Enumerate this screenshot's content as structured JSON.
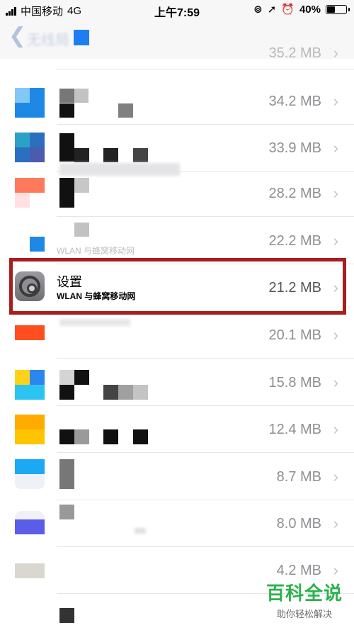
{
  "status_bar": {
    "carrier": "中国移动",
    "network": "4G",
    "time": "上午7:59",
    "battery": "40%",
    "battery_level": 0.4
  },
  "nav": {
    "back_label": "无线局"
  },
  "partial_top_size": "35.2 MB",
  "rows": [
    {
      "size": "34.2 MB"
    },
    {
      "size": "33.9 MB"
    },
    {
      "size": "28.2 MB"
    },
    {
      "size": "22.2 MB",
      "subtitle": "WLAN 与蜂窝移动网"
    },
    {
      "size": "21.2 MB",
      "name": "设置",
      "subtitle": "WLAN 与蜂窝移动网"
    },
    {
      "size": "20.1 MB"
    },
    {
      "size": "15.8 MB"
    },
    {
      "size": "12.4 MB"
    },
    {
      "size": "8.7 MB"
    },
    {
      "size": "8.0 MB"
    },
    {
      "size": "4.2 MB"
    }
  ],
  "watermark": {
    "title": "百科全说",
    "subtitle": "助你轻松解决"
  },
  "colors": {
    "highlight": "#a81d1d",
    "watermark": "#2bb24c",
    "chevron": "#c4c4c7"
  },
  "icons": {
    "back": "chevron-left-icon",
    "row_arrow": "chevron-right-icon",
    "settings": "settings-gear-icon"
  }
}
